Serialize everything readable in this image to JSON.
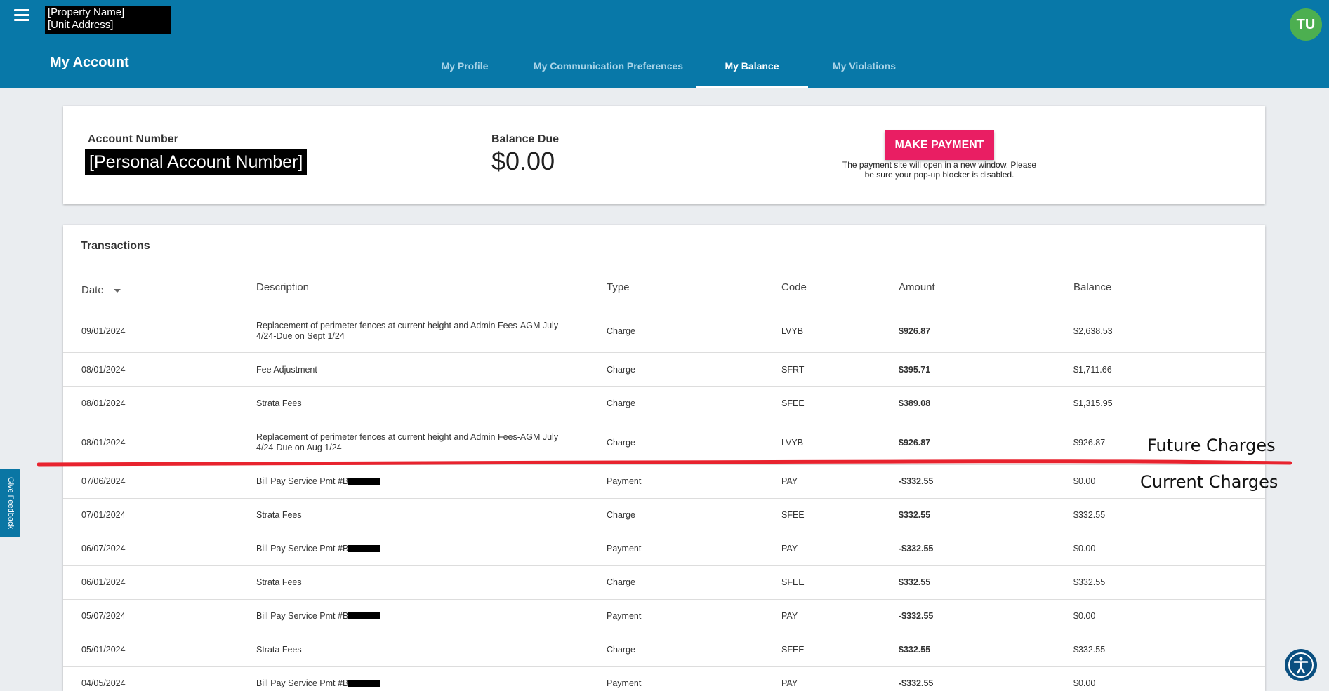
{
  "header": {
    "property_name": "[Property Name]",
    "unit_address": "[Unit Address]",
    "avatar_initials": "TU",
    "page_title": "My Account",
    "tabs": [
      {
        "label": "My Profile",
        "active": false
      },
      {
        "label": "My Communication Preferences",
        "active": false
      },
      {
        "label": "My Balance",
        "active": true
      },
      {
        "label": "My Violations",
        "active": false
      }
    ]
  },
  "summary": {
    "account_label": "Account Number",
    "account_number": "[Personal Account Number]",
    "balance_label": "Balance Due",
    "balance_value": "$0.00",
    "pay_button": "MAKE PAYMENT",
    "pay_note": "The payment site will open in a new window. Please be sure your pop-up blocker is disabled."
  },
  "transactions": {
    "title": "Transactions",
    "columns": [
      "Date",
      "Description",
      "Type",
      "Code",
      "Amount",
      "Balance"
    ],
    "rows": [
      {
        "date": "09/01/2024",
        "description": "Replacement of perimeter fences at current height and Admin Fees-AGM July 4/24-Due on Sept 1/24",
        "type": "Charge",
        "code": "LVYB",
        "amount": "$926.87",
        "balance": "$2,638.53"
      },
      {
        "date": "08/01/2024",
        "description": "Fee Adjustment",
        "type": "Charge",
        "code": "SFRT",
        "amount": "$395.71",
        "balance": "$1,711.66"
      },
      {
        "date": "08/01/2024",
        "description": "Strata Fees",
        "type": "Charge",
        "code": "SFEE",
        "amount": "$389.08",
        "balance": "$1,315.95"
      },
      {
        "date": "08/01/2024",
        "description": "Replacement of perimeter fences at current height and Admin Fees-AGM July 4/24-Due on Aug 1/24",
        "type": "Charge",
        "code": "LVYB",
        "amount": "$926.87",
        "balance": "$926.87"
      },
      {
        "date": "07/06/2024",
        "description": "Bill Pay Service Pmt #B",
        "type": "Payment",
        "code": "PAY",
        "amount": "-$332.55",
        "balance": "$0.00"
      },
      {
        "date": "07/01/2024",
        "description": "Strata Fees",
        "type": "Charge",
        "code": "SFEE",
        "amount": "$332.55",
        "balance": "$332.55"
      },
      {
        "date": "06/07/2024",
        "description": "Bill Pay Service Pmt #B",
        "type": "Payment",
        "code": "PAY",
        "amount": "-$332.55",
        "balance": "$0.00"
      },
      {
        "date": "06/01/2024",
        "description": "Strata Fees",
        "type": "Charge",
        "code": "SFEE",
        "amount": "$332.55",
        "balance": "$332.55"
      },
      {
        "date": "05/07/2024",
        "description": "Bill Pay Service Pmt #B",
        "type": "Payment",
        "code": "PAY",
        "amount": "-$332.55",
        "balance": "$0.00"
      },
      {
        "date": "05/01/2024",
        "description": "Strata Fees",
        "type": "Charge",
        "code": "SFEE",
        "amount": "$332.55",
        "balance": "$332.55"
      },
      {
        "date": "04/05/2024",
        "description": "Bill Pay Service Pmt #B",
        "type": "Payment",
        "code": "PAY",
        "amount": "-$332.55",
        "balance": "$0.00"
      }
    ]
  },
  "annotations": {
    "future": "Future Charges",
    "current": "Current Charges",
    "line_color": "#e8232e"
  },
  "feedback_label": "Give Feedback",
  "icons": {
    "menu": "hamburger-menu-icon",
    "accessibility": "accessibility-icon",
    "sort": "sort-desc-icon"
  }
}
